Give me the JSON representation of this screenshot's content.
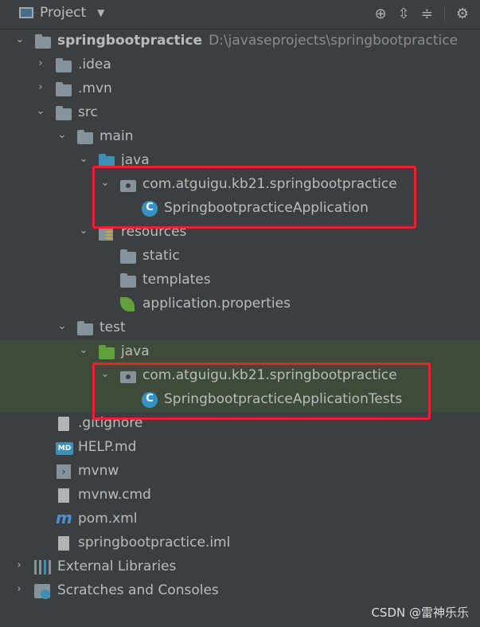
{
  "toolbar": {
    "title": "Project",
    "icons": [
      "window-icon",
      "chevron-down-icon",
      "locate-icon",
      "expand-all-icon",
      "collapse-all-icon",
      "gear-icon"
    ]
  },
  "tree": {
    "root": {
      "name": "springbootpractice",
      "path": "D:\\javaseprojects\\springbootpractice"
    },
    "idea": ".idea",
    "mvn": ".mvn",
    "src": "src",
    "main": "main",
    "main_java": "java",
    "main_pkg": "com.atguigu.kb21.springbootpractice",
    "main_class": "SpringbootpracticeApplication",
    "resources": "resources",
    "static": "static",
    "templates": "templates",
    "app_props": "application.properties",
    "test": "test",
    "test_java": "java",
    "test_pkg": "com.atguigu.kb21.springbootpractice",
    "test_class": "SpringbootpracticeApplicationTests",
    "gitignore": ".gitignore",
    "help": "HELP.md",
    "mvnw": "mvnw",
    "mvnw_cmd": "mvnw.cmd",
    "pom": "pom.xml",
    "iml": "springbootpractice.iml",
    "ext_libs": "External Libraries",
    "scratches": "Scratches and Consoles"
  },
  "watermark": "CSDN @雷神乐乐",
  "colors": {
    "background": "#3c3f41",
    "highlight_row": "#3e4b3a",
    "annotation_box": "#e8232a"
  }
}
